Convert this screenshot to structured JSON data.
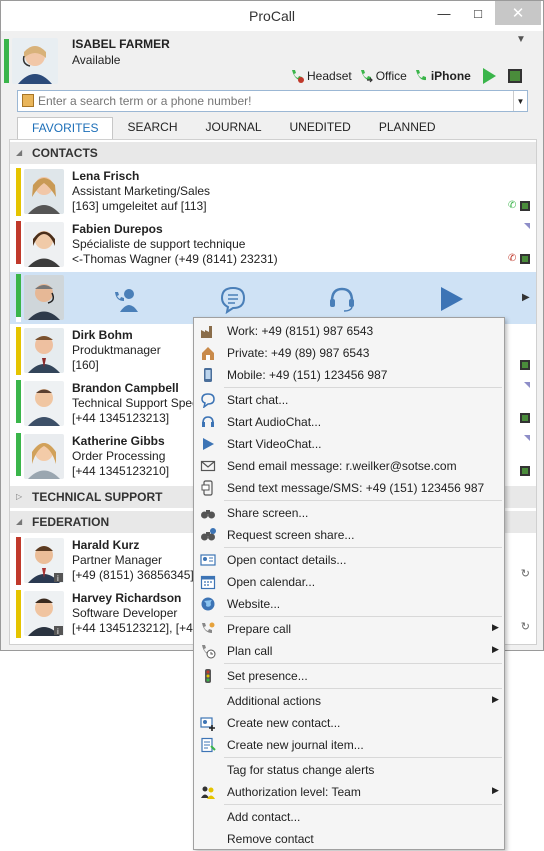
{
  "window": {
    "title": "ProCall",
    "minimize": "—",
    "maximize": "□",
    "close": "✕"
  },
  "me": {
    "name": "ISABEL FARMER",
    "status": "Available",
    "status_color": "#3ab54a"
  },
  "devices": [
    {
      "label": "Headset",
      "bold": false
    },
    {
      "label": "Office",
      "bold": false
    },
    {
      "label": "iPhone",
      "bold": true
    }
  ],
  "search": {
    "placeholder": "Enter a search term or a phone number!"
  },
  "tabs": [
    "FAVORITES",
    "SEARCH",
    "JOURNAL",
    "UNEDITED",
    "PLANNED"
  ],
  "groups": {
    "contacts": "CONTACTS",
    "technical": "TECHNICAL SUPPORT",
    "federation": "FEDERATION"
  },
  "contacts": [
    {
      "name": "Lena Frisch",
      "role": "Assistant Marketing/Sales",
      "info": "[163] umgeleitet auf [113]",
      "bar": "#e5c400"
    },
    {
      "name": "Fabien Durepos",
      "role": "Spécialiste de support technique",
      "info": "<-Thomas Wagner (+49 (8141) 23231)",
      "bar": "#c0392b"
    },
    {
      "name": "",
      "role": "",
      "info": "",
      "bar": "#3ab54a"
    },
    {
      "name": "Dirk Bohm",
      "role": "Produktmanager",
      "info": "[160]",
      "bar": "#e5c400"
    },
    {
      "name": "Brandon Campbell",
      "role": "Technical Support Spec",
      "info": "[+44 1345123213]",
      "bar": "#3ab54a"
    },
    {
      "name": "Katherine Gibbs",
      "role": "Order Processing",
      "info": "[+44 1345123210]",
      "bar": "#3ab54a"
    }
  ],
  "federation": [
    {
      "name": "Harald Kurz",
      "role": "Partner Manager",
      "info": "[+49 (8151) 36856345]",
      "bar": "#c0392b"
    },
    {
      "name": "Harvey Richardson",
      "role": "Software Developer",
      "info": "[+44 1345123212], [+44",
      "bar": "#e5c400"
    }
  ],
  "menu": {
    "work": "Work: +49 (8151) 987 6543",
    "private": "Private: +49 (89) 987 6543",
    "mobile": "Mobile: +49 (151) 123456 987",
    "start_chat": "Start chat...",
    "start_audio": "Start AudioChat...",
    "start_video": "Start VideoChat...",
    "send_email": "Send email message: r.weilker@sotse.com",
    "send_sms": "Send text message/SMS: +49 (151) 123456 987",
    "share_screen": "Share screen...",
    "request_share": "Request screen share...",
    "open_details": "Open contact details...",
    "open_calendar": "Open calendar...",
    "website": "Website...",
    "prepare_call": "Prepare call",
    "plan_call": "Plan call",
    "set_presence": "Set presence...",
    "additional": "Additional actions",
    "create_contact": "Create new contact...",
    "create_journal": "Create new journal item...",
    "tag_status": "Tag for status change alerts",
    "authorization": "Authorization level: Team",
    "add_contact": "Add contact...",
    "remove_contact": "Remove contact"
  }
}
